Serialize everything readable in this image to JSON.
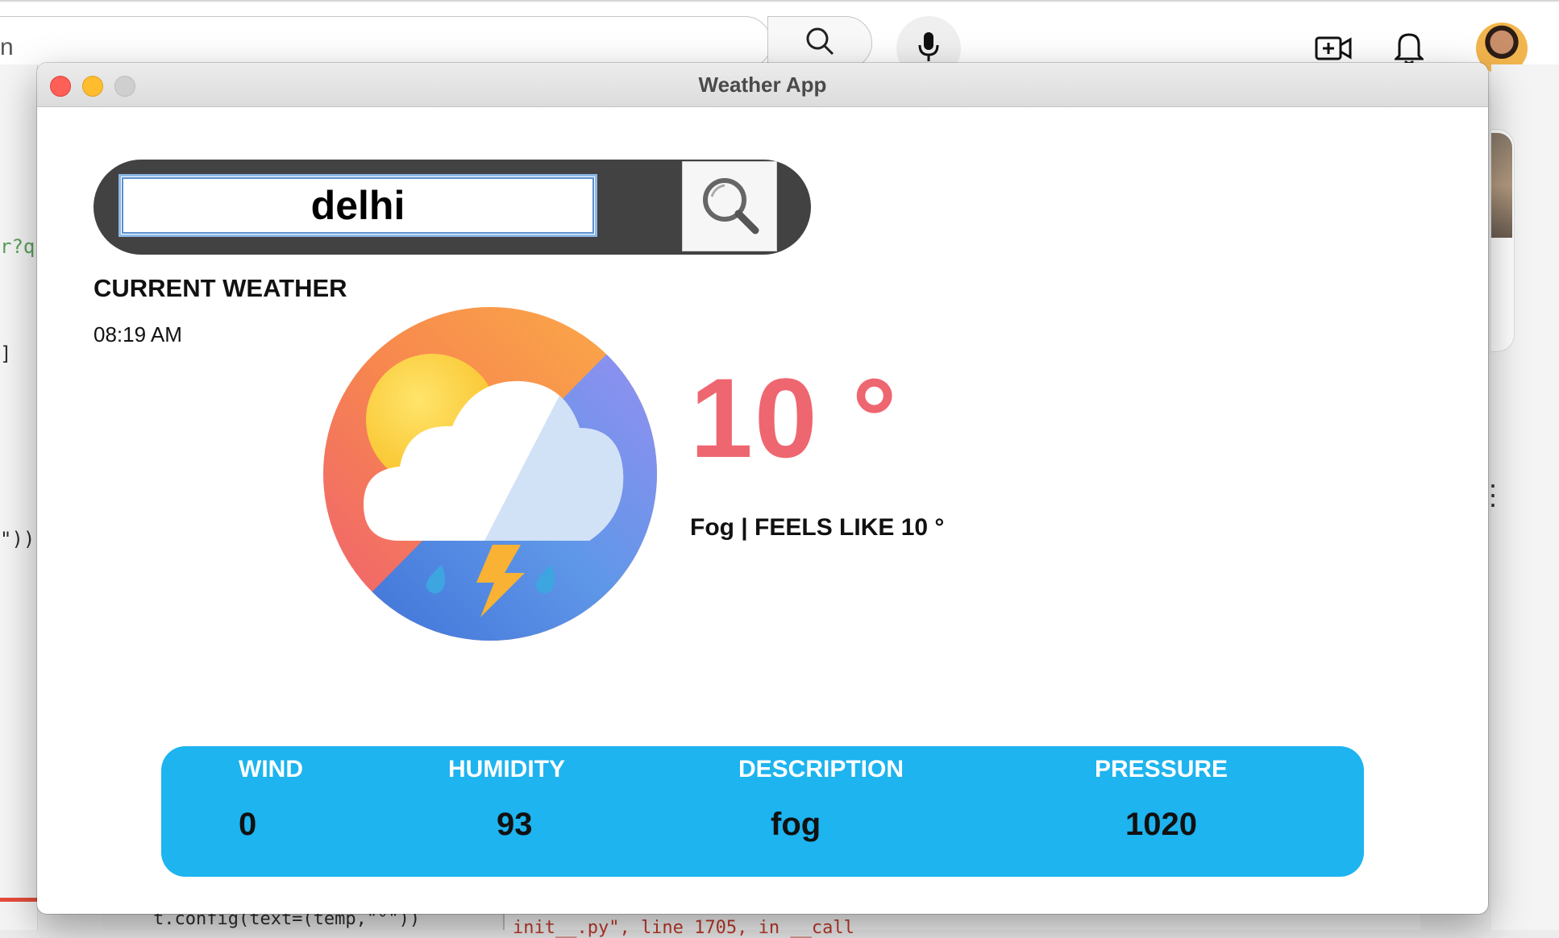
{
  "browser": {
    "search_partial_text": "n",
    "icons": [
      "search-icon",
      "microphone-icon",
      "create-video-icon",
      "bell-icon"
    ],
    "code_fragments": {
      "left_query": "r?q",
      "left_bracket": "]",
      "left_paren": "\"))",
      "editor_line": "t.config(text=(temp,\"°\"))",
      "console_line": "init__.py\", line 1705, in __call"
    }
  },
  "window": {
    "title": "Weather App"
  },
  "search": {
    "value": "delhi",
    "button_icon": "magnifier-icon"
  },
  "current": {
    "label": "CURRENT WEATHER",
    "time": "08:19 AM",
    "temperature": "10 °",
    "feels": "Fog | FEELS LIKE 10 °",
    "icon": "storm-cloud-sun-icon"
  },
  "info": {
    "wind_label": "WIND",
    "wind_value": "0",
    "humidity_label": "HUMIDITY",
    "humidity_value": "93",
    "description_label": "DESCRIPTION",
    "description_value": "fog",
    "pressure_label": "PRESSURE",
    "pressure_value": "1020"
  },
  "colors": {
    "accent_temp": "#ee6670",
    "info_panel": "#1db4ef",
    "search_pill": "#424242"
  }
}
